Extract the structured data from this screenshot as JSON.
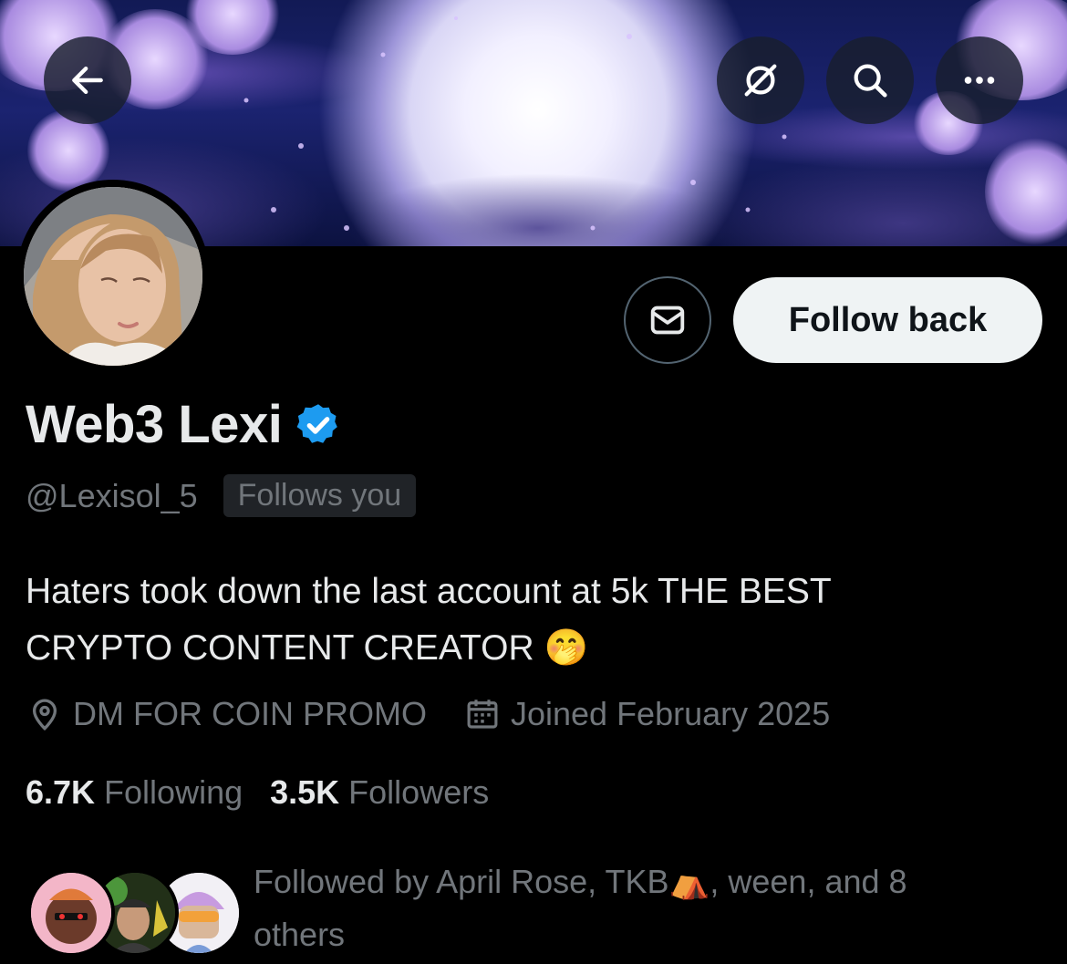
{
  "header": {
    "back_icon": "arrow-left-icon",
    "grok_icon": "slashed-circle-icon",
    "search_icon": "search-icon",
    "more_icon": "more-horizontal-icon"
  },
  "actions": {
    "message_icon": "envelope-icon",
    "follow_back_label": "Follow back"
  },
  "profile": {
    "display_name": "Web3 Lexi",
    "verified_icon": "verified-badge-icon",
    "handle": "@Lexisol_5",
    "follows_you_badge": "Follows you",
    "bio_line1": "Haters took down the last account at 5k THE BEST",
    "bio_line2": "CRYPTO CONTENT CREATOR",
    "bio_emoji": "🤭",
    "location": "DM FOR COIN PROMO",
    "joined": "Joined February 2025"
  },
  "stats": {
    "following_count": "6.7K",
    "following_label": "Following",
    "followers_count": "3.5K",
    "followers_label": "Followers"
  },
  "followed_by": {
    "prefix": "Followed by April Rose, TKB",
    "tent_emoji": "⛺",
    "suffix": ", ween, and 8",
    "line2": "others"
  },
  "colors": {
    "background": "#000000",
    "primary_text": "#e7e9ea",
    "secondary_text": "#71767b",
    "verified_blue": "#1d9bf0",
    "follow_button_bg": "#eff3f4"
  }
}
